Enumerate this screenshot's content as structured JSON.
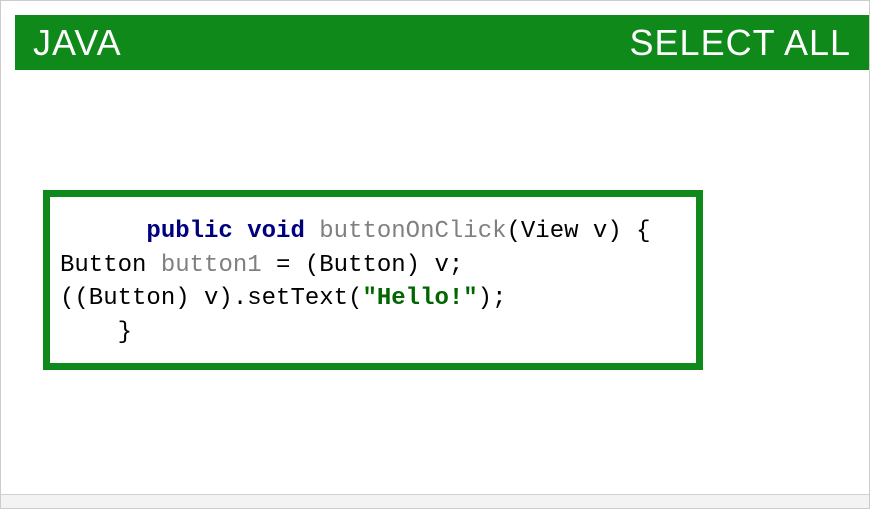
{
  "header": {
    "title": "JAVA",
    "select_all": "SELECT ALL"
  },
  "code": {
    "indent1": "      ",
    "kw_public": "public",
    "sp1": " ",
    "kw_void": "void",
    "sp2": " ",
    "method": "buttonOnClick",
    "sig_rest": "(View v) {",
    "line2_a": "Button ",
    "line2_ident": "button1",
    "line2_b": " = (Button) v;",
    "line3_a": "((Button) v).setText(",
    "line3_str": "\"Hello!\"",
    "line3_b": ");",
    "indent2": "    ",
    "close": "}"
  }
}
